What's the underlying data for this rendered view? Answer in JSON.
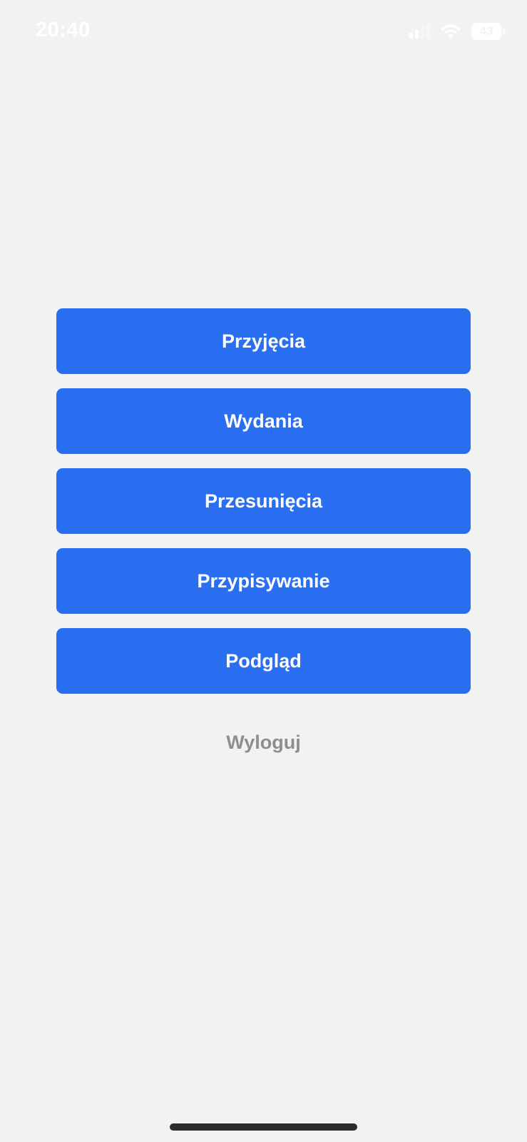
{
  "status_bar": {
    "time": "20:40",
    "battery_level": "43",
    "icons": [
      "signal-icon",
      "wifi-icon",
      "battery-icon"
    ]
  },
  "menu": {
    "buttons": [
      {
        "label": "Przyjęcia"
      },
      {
        "label": "Wydania"
      },
      {
        "label": "Przesunięcia"
      },
      {
        "label": "Przypisywanie"
      },
      {
        "label": "Podgląd"
      }
    ],
    "logout_label": "Wyloguj"
  },
  "colors": {
    "background": "#f2f2f2",
    "accent": "#2a6ff1",
    "button_text": "#ffffff",
    "logout_text": "#8e8e8e"
  }
}
